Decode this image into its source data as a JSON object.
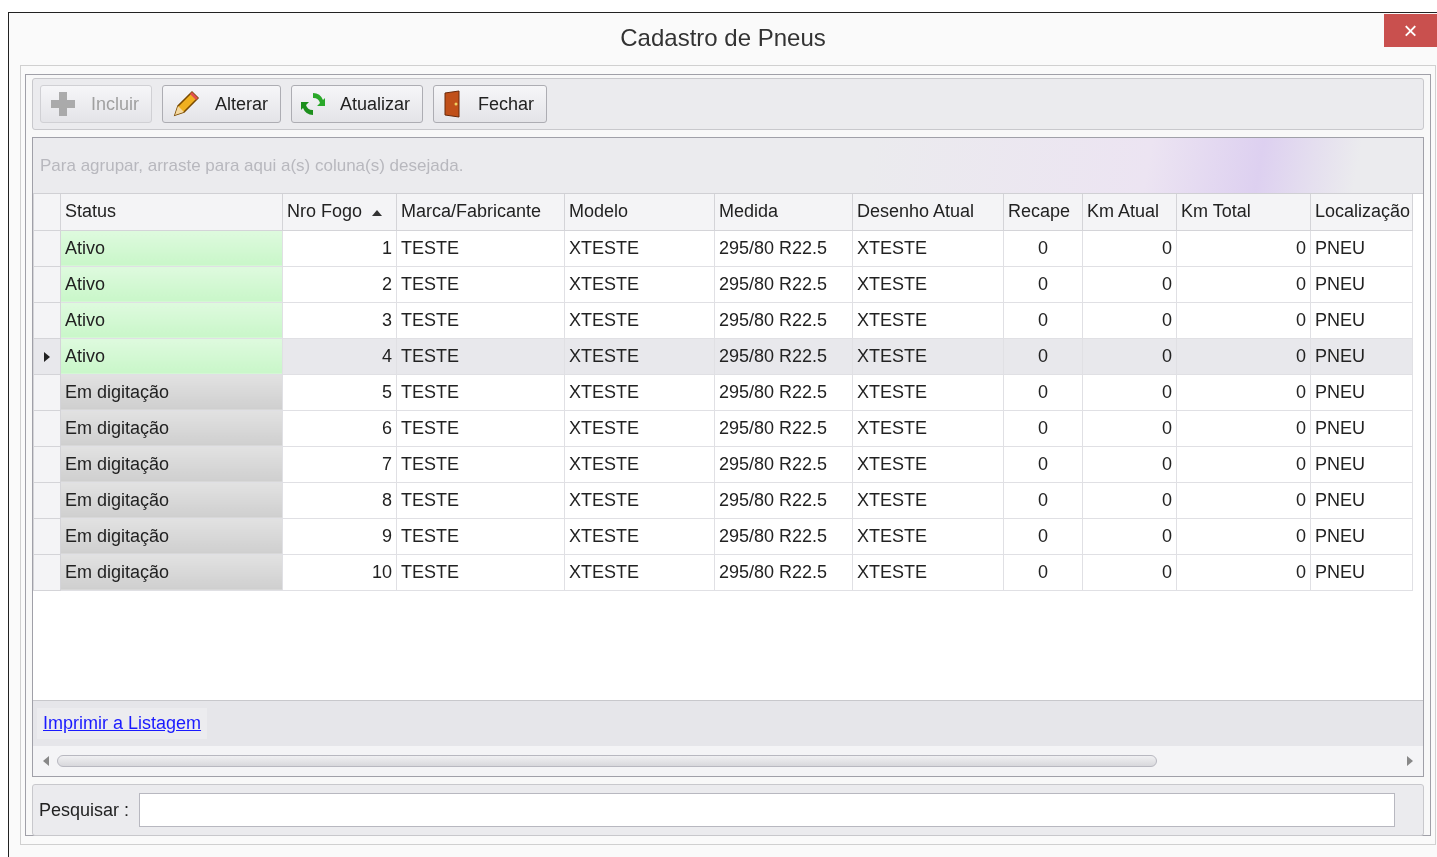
{
  "window": {
    "title": "Cadastro de Pneus",
    "close": "×"
  },
  "toolbar": [
    {
      "label": "Incluir",
      "kind": "add",
      "disabled": true
    },
    {
      "label": "Alterar",
      "kind": "edit",
      "disabled": false
    },
    {
      "label": "Atualizar",
      "kind": "refresh",
      "disabled": false
    },
    {
      "label": "Fechar",
      "kind": "close",
      "disabled": false
    }
  ],
  "group_panel": {
    "hint": "Para agrupar, arraste para aqui a(s) coluna(s) desejada."
  },
  "table": {
    "columns": [
      {
        "label": "Status",
        "kind": "text",
        "sorted": false
      },
      {
        "label": "Nro Fogo",
        "kind": "number",
        "sorted": true
      },
      {
        "label": "Marca/Fabricante",
        "kind": "text",
        "sorted": false
      },
      {
        "label": "Modelo",
        "kind": "text",
        "sorted": false
      },
      {
        "label": "Medida",
        "kind": "text",
        "sorted": false
      },
      {
        "label": "Desenho Atual",
        "kind": "text",
        "sorted": false
      },
      {
        "label": "Recape",
        "kind": "count",
        "sorted": false
      },
      {
        "label": "Km Atual",
        "kind": "number",
        "sorted": false
      },
      {
        "label": "Km Total",
        "kind": "number",
        "sorted": false
      },
      {
        "label": "Localização",
        "kind": "text",
        "sorted": false
      }
    ],
    "rows": [
      {
        "selected": false,
        "color": "#c9f7c9",
        "cells": [
          "Ativo",
          "1",
          "TESTE",
          "XTESTE",
          "295/80 R22.5",
          "XTESTE",
          "0",
          "0",
          "0",
          "PNEU"
        ]
      },
      {
        "selected": false,
        "color": "#c9f7c9",
        "cells": [
          "Ativo",
          "2",
          "TESTE",
          "XTESTE",
          "295/80 R22.5",
          "XTESTE",
          "0",
          "0",
          "0",
          "PNEU"
        ]
      },
      {
        "selected": false,
        "color": "#c9f7c9",
        "cells": [
          "Ativo",
          "3",
          "TESTE",
          "XTESTE",
          "295/80 R22.5",
          "XTESTE",
          "0",
          "0",
          "0",
          "PNEU"
        ]
      },
      {
        "selected": true,
        "color": "#c9f7c9",
        "cells": [
          "Ativo",
          "4",
          "TESTE",
          "XTESTE",
          "295/80 R22.5",
          "XTESTE",
          "0",
          "0",
          "0",
          "PNEU"
        ]
      },
      {
        "selected": false,
        "color": "#cfcfcf",
        "cells": [
          "Em digitação",
          "5",
          "TESTE",
          "XTESTE",
          "295/80 R22.5",
          "XTESTE",
          "0",
          "0",
          "0",
          "PNEU"
        ]
      },
      {
        "selected": false,
        "color": "#cfcfcf",
        "cells": [
          "Em digitação",
          "6",
          "TESTE",
          "XTESTE",
          "295/80 R22.5",
          "XTESTE",
          "0",
          "0",
          "0",
          "PNEU"
        ]
      },
      {
        "selected": false,
        "color": "#cfcfcf",
        "cells": [
          "Em digitação",
          "7",
          "TESTE",
          "XTESTE",
          "295/80 R22.5",
          "XTESTE",
          "0",
          "0",
          "0",
          "PNEU"
        ]
      },
      {
        "selected": false,
        "color": "#cfcfcf",
        "cells": [
          "Em digitação",
          "8",
          "TESTE",
          "XTESTE",
          "295/80 R22.5",
          "XTESTE",
          "0",
          "0",
          "0",
          "PNEU"
        ]
      },
      {
        "selected": false,
        "color": "#cfcfcf",
        "cells": [
          "Em digitação",
          "9",
          "TESTE",
          "XTESTE",
          "295/80 R22.5",
          "XTESTE",
          "0",
          "0",
          "0",
          "PNEU"
        ]
      },
      {
        "selected": false,
        "color": "#cfcfcf",
        "cells": [
          "Em digitação",
          "10",
          "TESTE",
          "XTESTE",
          "295/80 R22.5",
          "XTESTE",
          "0",
          "0",
          "0",
          "PNEU"
        ]
      }
    ]
  },
  "footer": {
    "link": "Imprimir a Listagem"
  },
  "search": {
    "label": "Pesquisar :"
  }
}
